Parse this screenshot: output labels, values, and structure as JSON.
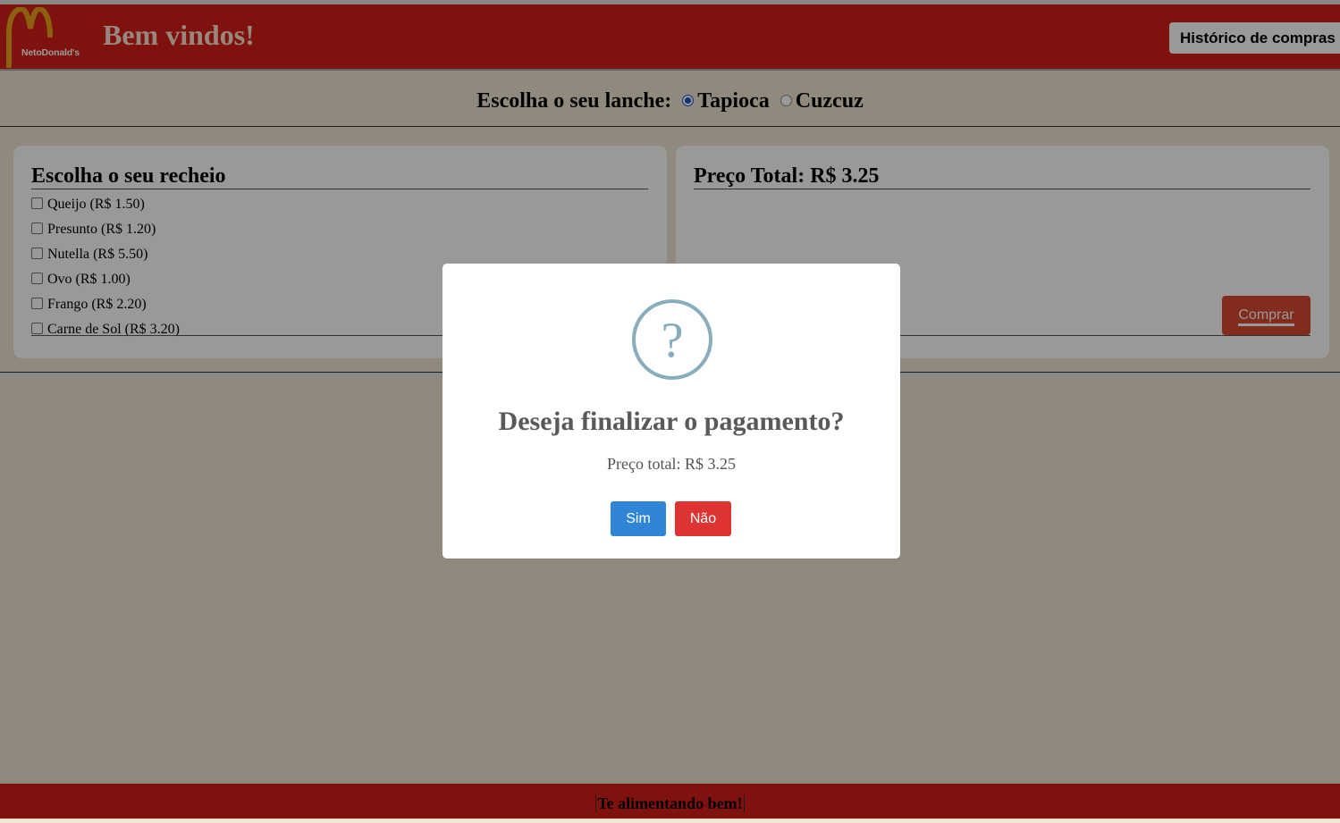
{
  "header": {
    "logo_text": "NetoDonald's",
    "welcome": "Bem vindos!",
    "history_button": "Histórico de compras"
  },
  "choice": {
    "label": "Escolha o seu lanche:",
    "options": [
      {
        "label": "Tapioca",
        "selected": true
      },
      {
        "label": "Cuzcuz",
        "selected": false
      }
    ]
  },
  "fillings_panel": {
    "title": "Escolha o seu recheio",
    "items": [
      {
        "label": "Queijo (R$ 1.50)",
        "checked": false
      },
      {
        "label": "Presunto (R$ 1.20)",
        "checked": false
      },
      {
        "label": "Nutella (R$ 5.50)",
        "checked": false
      },
      {
        "label": "Ovo (R$ 1.00)",
        "checked": false
      },
      {
        "label": "Frango (R$ 2.20)",
        "checked": false
      },
      {
        "label": "Carne de Sol (R$ 3.20)",
        "checked": false
      }
    ]
  },
  "total_panel": {
    "title": "Preço Total: R$ 3.25",
    "buy_button": "Comprar"
  },
  "footer": {
    "text": "Te alimentando bem!"
  },
  "modal": {
    "icon": "question-icon",
    "icon_glyph": "?",
    "title": "Deseja finalizar o pagamento?",
    "text": "Preço total: R$ 3.25",
    "confirm_button": "Sim",
    "cancel_button": "Não"
  },
  "colors": {
    "brand_red": "#d41f18",
    "logo_gold": "#e8a21c",
    "confirm_blue": "#3085d6",
    "cancel_red": "#dd3333",
    "icon_blue": "#87adbd"
  }
}
